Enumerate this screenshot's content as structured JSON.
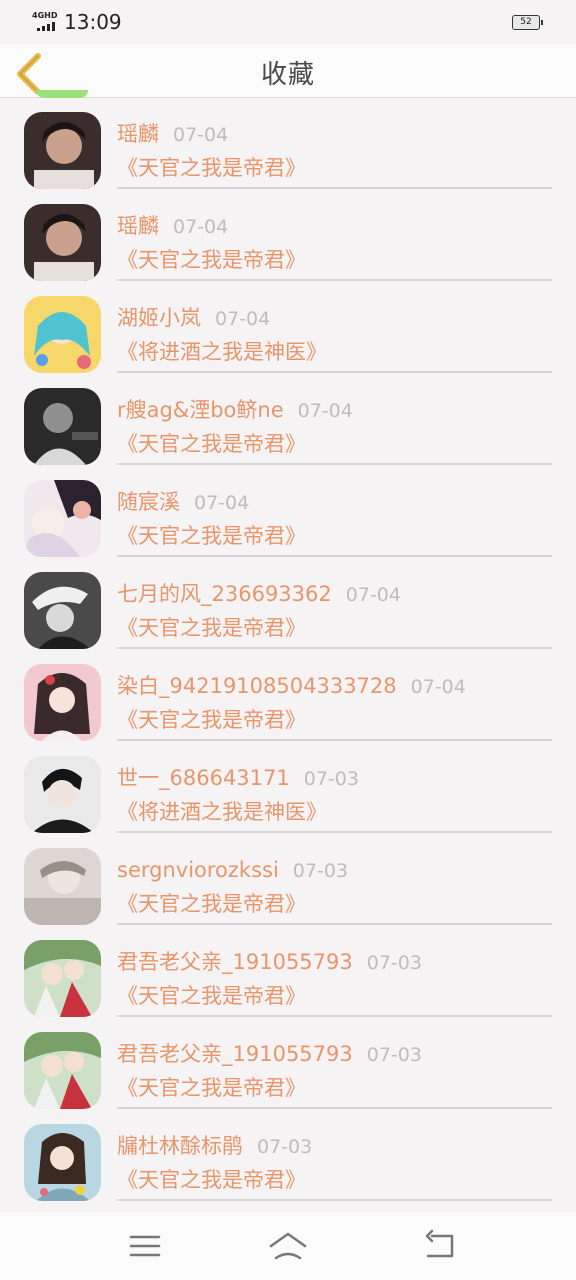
{
  "status_bar": {
    "network": "4GHD",
    "time": "13:09",
    "battery": "52"
  },
  "header": {
    "title": "收藏",
    "back_icon": "chevron-left-icon",
    "accent_color": "#e8b84a"
  },
  "colors": {
    "name": "#e8956a",
    "date": "#bdbdbd",
    "divider": "#d6d6d6",
    "background": "#f5f3f4"
  },
  "items": [
    {
      "name": "瑶麟",
      "date": "07-04",
      "book": "《天官之我是帝君》"
    },
    {
      "name": "瑶麟",
      "date": "07-04",
      "book": "《天官之我是帝君》"
    },
    {
      "name": "湖姬小岚",
      "date": "07-04",
      "book": "《将进酒之我是神医》"
    },
    {
      "name": "r艘ag&湮bo鲚ne",
      "date": "07-04",
      "book": "《天官之我是帝君》"
    },
    {
      "name": "随宸溪",
      "date": "07-04",
      "book": "《天官之我是帝君》"
    },
    {
      "name": "七月的风_236693362",
      "date": "07-04",
      "book": "《天官之我是帝君》"
    },
    {
      "name": "染白_94219108504333728",
      "date": "07-04",
      "book": "《天官之我是帝君》"
    },
    {
      "name": "世一_686643171",
      "date": "07-03",
      "book": "《将进酒之我是神医》"
    },
    {
      "name": "sergnviorozkssi",
      "date": "07-03",
      "book": "《天官之我是帝君》"
    },
    {
      "name": "君吾老父亲_191055793",
      "date": "07-03",
      "book": "《天官之我是帝君》"
    },
    {
      "name": "君吾老父亲_191055793",
      "date": "07-03",
      "book": "《天官之我是帝君》"
    },
    {
      "name": "牖杜林酴标鹃",
      "date": "07-03",
      "book": "《天官之我是帝君》"
    }
  ],
  "nav_bar": {
    "menu_icon": "menu-icon",
    "home_icon": "home-icon",
    "back_icon": "return-icon"
  }
}
